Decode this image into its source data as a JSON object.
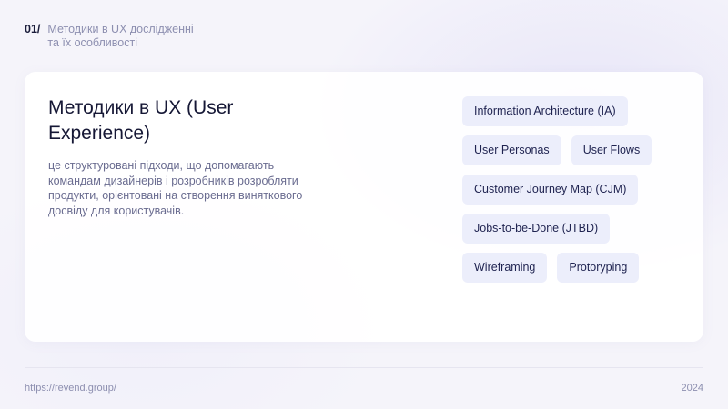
{
  "header": {
    "slide_number": "01/",
    "title_line1": "Методики в UX дослідженні",
    "title_line2": "та їх особливості"
  },
  "card": {
    "heading_line1": "Методики в UX (User",
    "heading_line2": "Experience)",
    "description_lines": [
      "це структуровані підходи, що допомагають",
      "командам дизайнерів і розробників розробляти",
      "продукти, орієнтовані на створення виняткового",
      "досвіду для користувачів."
    ],
    "tag_rows": [
      [
        "Information Architecture (IA)"
      ],
      [
        "User Personas",
        "User Flows"
      ],
      [
        "Customer Journey Map (CJM)"
      ],
      [
        "Jobs-to-be-Done (JTBD)"
      ],
      [
        "Wireframing",
        "Protoryping"
      ]
    ]
  },
  "footer": {
    "url": "https://revend.group/",
    "year": "2024"
  }
}
